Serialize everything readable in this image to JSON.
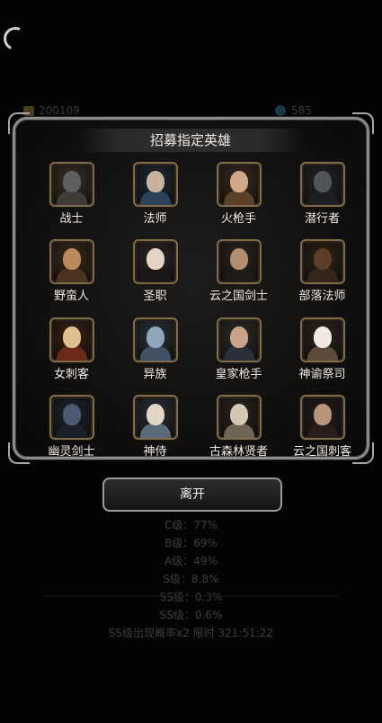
{
  "currency": {
    "gold": "200109",
    "gems": "585"
  },
  "panel": {
    "title": "招募指定英雄"
  },
  "heroes": [
    {
      "name": "战士",
      "colors": {
        "bg": "#3b3226",
        "head": "#5d5f63",
        "body": "#3f3a33"
      }
    },
    {
      "name": "法师",
      "colors": {
        "bg": "#1e2a36",
        "head": "#c7b39d",
        "body": "#2c4258"
      }
    },
    {
      "name": "火枪手",
      "colors": {
        "bg": "#3a2d22",
        "head": "#d2a988",
        "body": "#5a3f2a"
      }
    },
    {
      "name": "潜行者",
      "colors": {
        "bg": "#23252a",
        "head": "#505458",
        "body": "#1e1f23"
      }
    },
    {
      "name": "野蛮人",
      "colors": {
        "bg": "#3b2c1d",
        "head": "#b98a5c",
        "body": "#4b3320"
      }
    },
    {
      "name": "圣职",
      "colors": {
        "bg": "#2d2828",
        "head": "#e5d3c3",
        "body": "#1b1716"
      }
    },
    {
      "name": "云之国剑士",
      "colors": {
        "bg": "#2b2621",
        "head": "#b38d70",
        "body": "#1f1b18"
      }
    },
    {
      "name": "部落法师",
      "colors": {
        "bg": "#2e2419",
        "head": "#5e3d28",
        "body": "#35261b"
      }
    },
    {
      "name": "女刺客",
      "colors": {
        "bg": "#3a2216",
        "head": "#e1c090",
        "body": "#6a2a1a"
      }
    },
    {
      "name": "异族",
      "colors": {
        "bg": "#2a3540",
        "head": "#90a6bb",
        "body": "#3f5163"
      }
    },
    {
      "name": "皇家枪手",
      "colors": {
        "bg": "#2d2d2d",
        "head": "#c8a388",
        "body": "#2a2f3a"
      }
    },
    {
      "name": "神谕祭司",
      "colors": {
        "bg": "#2f2621",
        "head": "#f0eae2",
        "body": "#5d4a3b"
      }
    },
    {
      "name": "幽灵剑士",
      "colors": {
        "bg": "#1d2430",
        "head": "#4a5a70",
        "body": "#1b2028"
      }
    },
    {
      "name": "神侍",
      "colors": {
        "bg": "#2b3038",
        "head": "#e3d6c6",
        "body": "#5a6a7a"
      }
    },
    {
      "name": "古森林贤者",
      "colors": {
        "bg": "#2a2621",
        "head": "#d4c7b4",
        "body": "#6e6556"
      }
    },
    {
      "name": "云之国刺客",
      "colors": {
        "bg": "#251e1c",
        "head": "#b89478",
        "body": "#2b1e1a"
      }
    }
  ],
  "leave_button": {
    "label": "离开"
  },
  "rates": [
    "C级：77%",
    "B级：69%",
    "A级：49%",
    "S级：8.8%",
    "SS级：0.3%",
    "SS级：0.6%",
    "SS级出现概率x2 限时 321:51:22"
  ]
}
